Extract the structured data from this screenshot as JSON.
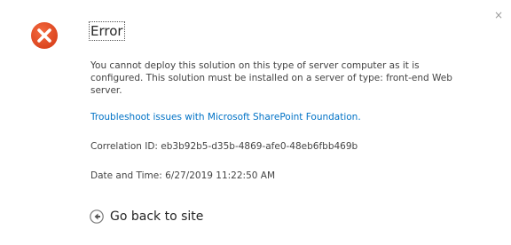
{
  "dialog": {
    "title": "Error",
    "close_symbol": "×",
    "message": "You cannot deploy this solution on this type of server computer as it is configured. This solution must be installed on a server of type: front-end Web server.",
    "troubleshoot_link": "Troubleshoot issues with Microsoft SharePoint Foundation.",
    "correlation": "Correlation ID: eb3b92b5-d35b-4869-afe0-48eb6fbb469b",
    "date_time": "Date and Time: 6/27/2019 11:22:50 AM",
    "back_label": "Go back to site"
  },
  "icons": {
    "error": "error-x-circle-icon",
    "close": "close-icon",
    "back": "back-arrow-circle-icon"
  },
  "colors": {
    "error_red": "#e04a21",
    "link_blue": "#0072c6",
    "text": "#444444",
    "title": "#262626"
  }
}
